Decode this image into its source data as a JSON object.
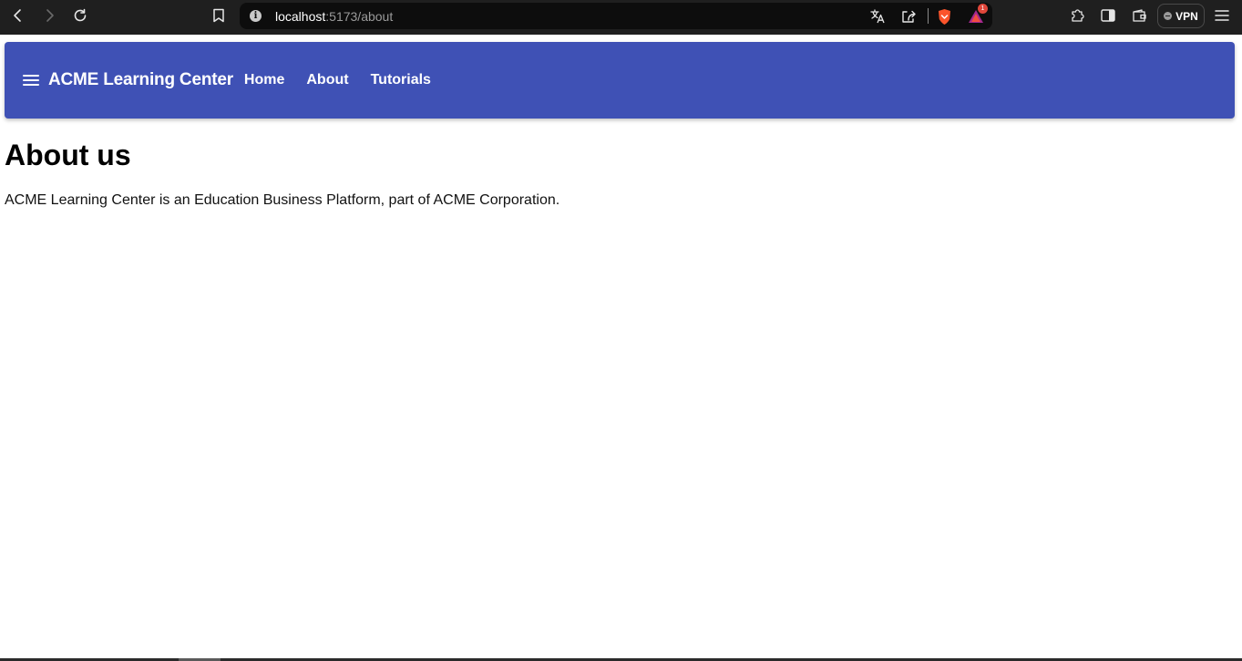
{
  "browser": {
    "url_host": "localhost",
    "url_rest": ":5173/about",
    "icons": [
      "back-icon",
      "forward-icon",
      "reload-icon",
      "bookmark-icon",
      "info-icon",
      "translate-icon",
      "share-icon",
      "brave-shields-icon",
      "brave-rewards-icon",
      "extensions-icon",
      "sidebar-icon",
      "wallet-icon",
      "vpn-icon",
      "menu-icon"
    ],
    "rewards_badge": "1",
    "vpn_label": "VPN"
  },
  "appbar": {
    "background": "#3f51b5",
    "brand": "ACME Learning Center",
    "nav": [
      "Home",
      "About",
      "Tutorials"
    ]
  },
  "page": {
    "title": "About us",
    "text": "ACME Learning Center is an Education Business Platform, part of ACME Corporation."
  }
}
